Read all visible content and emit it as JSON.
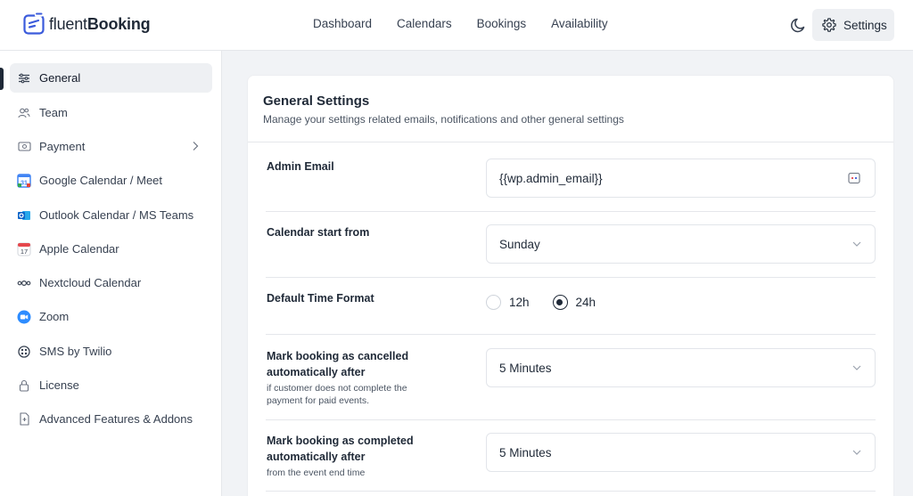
{
  "brand": {
    "name_light": "fluent",
    "name_bold": "Booking"
  },
  "nav": {
    "items": [
      "Dashboard",
      "Calendars",
      "Bookings",
      "Availability"
    ]
  },
  "header": {
    "theme_icon": "moon-icon",
    "settings_label": "Settings"
  },
  "sidebar": {
    "items": [
      {
        "label": "General",
        "icon": "sliders-icon"
      },
      {
        "label": "Team",
        "icon": "users-icon"
      },
      {
        "label": "Payment",
        "icon": "payment-icon"
      },
      {
        "label": "Google Calendar / Meet",
        "icon": "google-calendar-icon"
      },
      {
        "label": "Outlook Calendar / MS Teams",
        "icon": "outlook-icon"
      },
      {
        "label": "Apple Calendar",
        "icon": "apple-calendar-icon"
      },
      {
        "label": "Nextcloud Calendar",
        "icon": "nextcloud-icon"
      },
      {
        "label": "Zoom",
        "icon": "zoom-icon"
      },
      {
        "label": "SMS by Twilio",
        "icon": "twilio-icon"
      },
      {
        "label": "License",
        "icon": "lock-icon"
      },
      {
        "label": "Advanced Features & Addons",
        "icon": "addons-icon"
      }
    ]
  },
  "main": {
    "title": "General Settings",
    "subtitle": "Manage your settings related emails, notifications and other general settings",
    "admin_email": {
      "label": "Admin Email",
      "value": "{{wp.admin_email}}"
    },
    "calendar_start": {
      "label": "Calendar start from",
      "value": "Sunday"
    },
    "time_format": {
      "label": "Default Time Format",
      "options": [
        "12h",
        "24h"
      ],
      "selected": "24h"
    },
    "auto_cancel": {
      "label_line1": "Mark booking as cancelled",
      "label_line2": "automatically after",
      "help_line1": "if customer does not complete the",
      "help_line2": "payment for paid events.",
      "value": "5 Minutes"
    },
    "auto_complete": {
      "label_line1": "Mark booking as completed",
      "label_line2": "automatically after",
      "help": "from the event end time",
      "value": "5 Minutes"
    }
  },
  "colors": {
    "accent": "#1f2937",
    "google_blue": "#4285f4",
    "outlook_blue": "#0a64c8",
    "zoom_blue": "#2d8cff",
    "apple_red": "#e5484d"
  }
}
